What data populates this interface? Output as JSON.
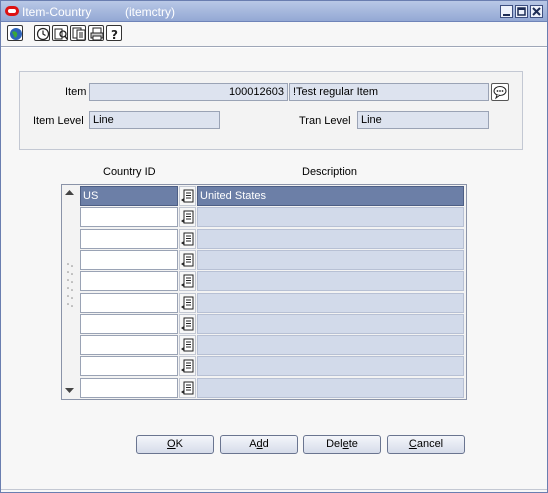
{
  "window": {
    "title": "Item-Country",
    "module": "(itemctry)"
  },
  "toolbar": {
    "icons": [
      "globe-icon",
      "history-icon",
      "find-icon",
      "copy-icon",
      "print-icon",
      "help-icon"
    ]
  },
  "header": {
    "item_label": "Item",
    "item_number": "100012603",
    "item_desc": "!Test regular Item",
    "item_level_label": "Item Level",
    "item_level_value": "Line",
    "tran_level_label": "Tran Level",
    "tran_level_value": "Line"
  },
  "grid": {
    "columns": [
      "Country ID",
      "Description"
    ],
    "rows": [
      {
        "country_id": "US",
        "description": "United States"
      },
      {
        "country_id": "",
        "description": ""
      },
      {
        "country_id": "",
        "description": ""
      },
      {
        "country_id": "",
        "description": ""
      },
      {
        "country_id": "",
        "description": ""
      },
      {
        "country_id": "",
        "description": ""
      },
      {
        "country_id": "",
        "description": ""
      },
      {
        "country_id": "",
        "description": ""
      },
      {
        "country_id": "",
        "description": ""
      },
      {
        "country_id": "",
        "description": ""
      }
    ]
  },
  "buttons": {
    "ok": {
      "mnemonic": "O",
      "rest": "K"
    },
    "add": {
      "pre": "A",
      "mnemonic": "d",
      "rest": "d"
    },
    "delete": {
      "pre": "Del",
      "mnemonic": "e",
      "rest": "te"
    },
    "cancel": {
      "mnemonic": "C",
      "rest": "ancel"
    }
  },
  "colors": {
    "title_bar": "#93a8d4",
    "selected_row": "#6c7fa7",
    "field_bg": "#dde3ef"
  }
}
